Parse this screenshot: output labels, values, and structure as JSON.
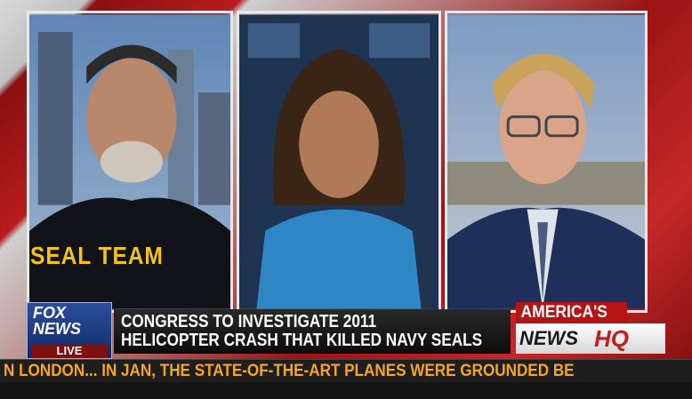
{
  "shirt": {
    "text": "SEAL TEAM"
  },
  "lower_third": {
    "logo": {
      "line1": "FOX",
      "line2": "NEWS",
      "live": "LIVE"
    },
    "headline": {
      "line1": "CONGRESS TO INVESTIGATE 2011",
      "line2": "HELICOPTER CRASH THAT KILLED NAVY SEALS"
    },
    "brand": {
      "top": "AMERICA'S",
      "news": "NEWS",
      "hq": "HQ"
    }
  },
  "ticker": {
    "text": "N LONDON... IN JAN, THE STATE-OF-THE-ART PLANES WERE GROUNDED BE"
  },
  "colors": {
    "headline_text": "#ffffff",
    "ticker_text": "#f5a623",
    "brand_red": "#b51414",
    "fox_blue": "#1f3f8a"
  }
}
